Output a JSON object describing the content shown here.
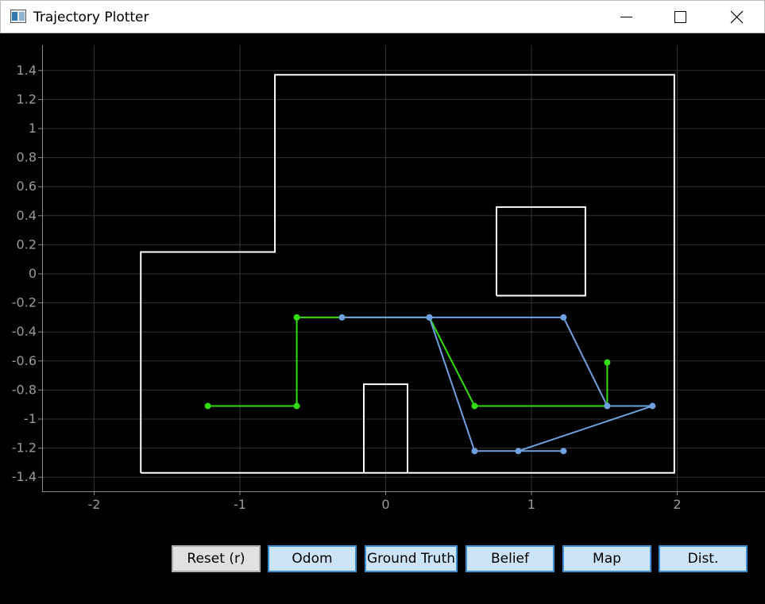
{
  "window": {
    "title": "Trajectory Plotter"
  },
  "buttons": {
    "reset": "Reset (r)",
    "odom": "Odom",
    "ground_truth": "Ground Truth",
    "belief": "Belief",
    "map": "Map",
    "dist": "Dist."
  },
  "colors": {
    "background": "#000000",
    "grid": "#333333",
    "map": "#ffffff",
    "ground_truth": "#33dd11",
    "belief": "#6fa0e0"
  },
  "chart_data": {
    "type": "line",
    "xlim": [
      -2.35,
      2.6
    ],
    "ylim": [
      -1.5,
      1.55
    ],
    "x_ticks": [
      -2,
      -1,
      0,
      1,
      2
    ],
    "y_ticks": [
      1.4,
      1.2,
      1,
      0.8,
      0.6,
      0.4,
      0.2,
      0,
      -0.2,
      -0.4,
      -0.6,
      -0.8,
      -1,
      -1.2,
      -1.4
    ],
    "x_tick_labels": [
      "-2",
      "-1",
      "0",
      "1",
      "2"
    ],
    "y_tick_labels": [
      "1.4",
      "1.2",
      "1",
      "0.8",
      "0.6",
      "0.4",
      "0.2",
      "0",
      "-0.2",
      "-0.4",
      "-0.6",
      "-0.8",
      "-1",
      "-1.2",
      "-1.4"
    ],
    "grid": true,
    "series": [
      {
        "key": "map",
        "segments": [
          [
            [
              -1.68,
              -1.37
            ],
            [
              -1.68,
              0.15
            ],
            [
              -0.76,
              0.15
            ],
            [
              -0.76,
              1.37
            ],
            [
              1.98,
              1.37
            ],
            [
              1.98,
              -1.37
            ],
            [
              -1.68,
              -1.37
            ]
          ],
          [
            [
              0.76,
              -0.15
            ],
            [
              0.76,
              0.46
            ],
            [
              1.37,
              0.46
            ],
            [
              1.37,
              -0.15
            ],
            [
              0.76,
              -0.15
            ]
          ],
          [
            [
              -0.15,
              -1.37
            ],
            [
              -0.15,
              -0.76
            ],
            [
              0.15,
              -0.76
            ],
            [
              0.15,
              -1.37
            ]
          ]
        ]
      },
      {
        "key": "ground_truth",
        "points": [
          [
            -1.22,
            -0.91
          ],
          [
            -0.61,
            -0.91
          ],
          [
            -0.61,
            -0.3
          ],
          [
            0.3,
            -0.3
          ],
          [
            0.61,
            -0.91
          ],
          [
            1.52,
            -0.91
          ],
          [
            1.52,
            -0.61
          ]
        ]
      },
      {
        "key": "belief",
        "points": [
          [
            -0.3,
            -0.3
          ],
          [
            0.3,
            -0.3
          ],
          [
            1.22,
            -0.3
          ],
          [
            1.52,
            -0.91
          ],
          [
            1.83,
            -0.91
          ],
          [
            0.91,
            -1.22
          ],
          [
            0.61,
            -1.22
          ],
          [
            0.3,
            -0.3
          ]
        ],
        "extra_points": [
          [
            1.22,
            -1.22
          ]
        ],
        "extra_segments": [
          [
            [
              0.91,
              -1.22
            ],
            [
              1.22,
              -1.22
            ]
          ]
        ]
      }
    ]
  }
}
